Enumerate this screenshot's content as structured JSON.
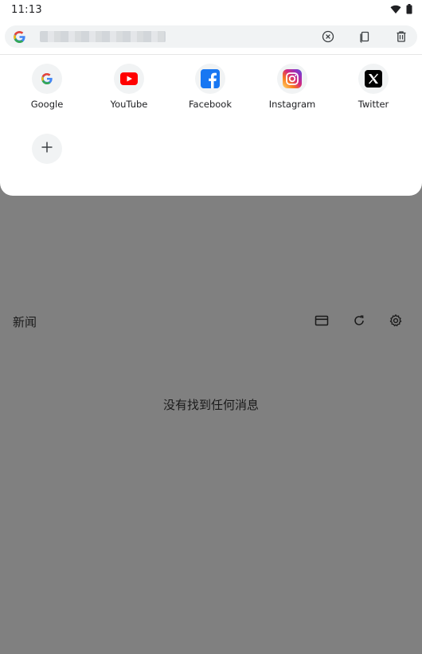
{
  "status_bar": {
    "time": "11:13",
    "icons": [
      "wifi-icon",
      "battery-icon"
    ]
  },
  "search_bar": {
    "logo": "google-g-icon",
    "url": "",
    "buttons": [
      "clear-icon",
      "tab-switcher-icon",
      "delete-icon"
    ]
  },
  "shortcuts": [
    {
      "label": "Google",
      "icon": "google-icon"
    },
    {
      "label": "YouTube",
      "icon": "youtube-icon"
    },
    {
      "label": "Facebook",
      "icon": "facebook-icon"
    },
    {
      "label": "Instagram",
      "icon": "instagram-icon"
    },
    {
      "label": "Twitter",
      "icon": "x-icon"
    }
  ],
  "add_shortcut_icon": "plus-icon",
  "news": {
    "title": "新闻",
    "buttons": [
      "card-icon",
      "refresh-icon",
      "gear-icon"
    ],
    "empty_message": "没有找到任何消息"
  },
  "colors": {
    "backdrop": "#808080",
    "sheet": "#ffffff",
    "youtube_red": "#ff0000",
    "facebook_blue": "#1877f2"
  }
}
